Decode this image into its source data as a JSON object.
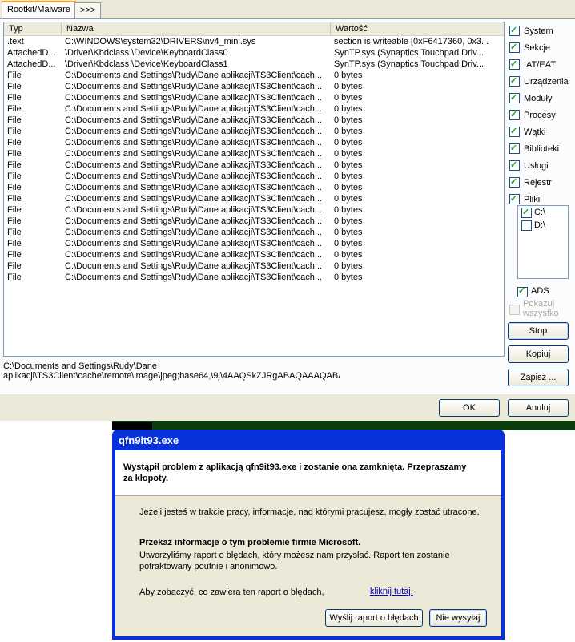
{
  "tabs": [
    {
      "label": "Rootkit/Malware"
    },
    {
      "label": ">>>"
    }
  ],
  "list": {
    "columns": [
      "Typ",
      "Nazwa",
      "Wartość"
    ],
    "rows": [
      [
        ".text",
        "C:\\WINDOWS\\system32\\DRIVERS\\nv4_mini.sys",
        "section is writeable [0xF6417360, 0x3..."
      ],
      [
        "AttachedD...",
        "\\Driver\\Kbdclass \\Device\\KeyboardClass0",
        "SynTP.sys (Synaptics Touchpad Driv..."
      ],
      [
        "AttachedD...",
        "\\Driver\\Kbdclass \\Device\\KeyboardClass1",
        "SynTP.sys (Synaptics Touchpad Driv..."
      ],
      [
        "File",
        "C:\\Documents and Settings\\Rudy\\Dane aplikacji\\TS3Client\\cach...",
        "0 bytes"
      ],
      [
        "File",
        "C:\\Documents and Settings\\Rudy\\Dane aplikacji\\TS3Client\\cach...",
        "0 bytes"
      ],
      [
        "File",
        "C:\\Documents and Settings\\Rudy\\Dane aplikacji\\TS3Client\\cach...",
        "0 bytes"
      ],
      [
        "File",
        "C:\\Documents and Settings\\Rudy\\Dane aplikacji\\TS3Client\\cach...",
        "0 bytes"
      ],
      [
        "File",
        "C:\\Documents and Settings\\Rudy\\Dane aplikacji\\TS3Client\\cach...",
        "0 bytes"
      ],
      [
        "File",
        "C:\\Documents and Settings\\Rudy\\Dane aplikacji\\TS3Client\\cach...",
        "0 bytes"
      ],
      [
        "File",
        "C:\\Documents and Settings\\Rudy\\Dane aplikacji\\TS3Client\\cach...",
        "0 bytes"
      ],
      [
        "File",
        "C:\\Documents and Settings\\Rudy\\Dane aplikacji\\TS3Client\\cach...",
        "0 bytes"
      ],
      [
        "File",
        "C:\\Documents and Settings\\Rudy\\Dane aplikacji\\TS3Client\\cach...",
        "0 bytes"
      ],
      [
        "File",
        "C:\\Documents and Settings\\Rudy\\Dane aplikacji\\TS3Client\\cach...",
        "0 bytes"
      ],
      [
        "File",
        "C:\\Documents and Settings\\Rudy\\Dane aplikacji\\TS3Client\\cach...",
        "0 bytes"
      ],
      [
        "File",
        "C:\\Documents and Settings\\Rudy\\Dane aplikacji\\TS3Client\\cach...",
        "0 bytes"
      ],
      [
        "File",
        "C:\\Documents and Settings\\Rudy\\Dane aplikacji\\TS3Client\\cach...",
        "0 bytes"
      ],
      [
        "File",
        "C:\\Documents and Settings\\Rudy\\Dane aplikacji\\TS3Client\\cach...",
        "0 bytes"
      ],
      [
        "File",
        "C:\\Documents and Settings\\Rudy\\Dane aplikacji\\TS3Client\\cach...",
        "0 bytes"
      ],
      [
        "File",
        "C:\\Documents and Settings\\Rudy\\Dane aplikacji\\TS3Client\\cach...",
        "0 bytes"
      ],
      [
        "File",
        "C:\\Documents and Settings\\Rudy\\Dane aplikacji\\TS3Client\\cach...",
        "0 bytes"
      ],
      [
        "File",
        "C:\\Documents and Settings\\Rudy\\Dane aplikacji\\TS3Client\\cach...",
        "0 bytes"
      ],
      [
        "File",
        "C:\\Documents and Settings\\Rudy\\Dane aplikacji\\TS3Client\\cach...",
        "0 bytes"
      ]
    ]
  },
  "path_text": {
    "line1": "C:\\Documents and Settings\\Rudy\\Dane",
    "line2": "aplikacji\\TS3Client\\cache\\remote\\image\\jpeg;base64,\\9j\\4AAQSkZJRgABAQAAAQABA"
  },
  "options": [
    {
      "label": "System",
      "checked": true
    },
    {
      "label": "Sekcje",
      "checked": true
    },
    {
      "label": "IAT/EAT",
      "checked": true
    },
    {
      "label": "Urządzenia",
      "checked": true
    },
    {
      "label": "Moduły",
      "checked": true
    },
    {
      "label": "Procesy",
      "checked": true
    },
    {
      "label": "Wątki",
      "checked": true
    },
    {
      "label": "Biblioteki",
      "checked": true
    },
    {
      "label": "Usługi",
      "checked": true
    },
    {
      "label": "Rejestr",
      "checked": true
    },
    {
      "label": "Pliki",
      "checked": true
    }
  ],
  "drives": [
    {
      "label": "C:\\",
      "checked": true
    },
    {
      "label": "D:\\",
      "checked": false
    }
  ],
  "ads": {
    "label": "ADS",
    "checked": true
  },
  "pokazuj": {
    "label": "Pokazuj wszystko",
    "checked": false,
    "disabled": true
  },
  "buttons": {
    "stop": "Stop",
    "kopiuj": "Kopiuj",
    "zapisz": "Zapisz ...",
    "ok": "OK",
    "anuluj": "Anuluj"
  },
  "error_dialog": {
    "title": "qfn9it93.exe",
    "headline": "Wystąpił problem z aplikacją qfn9it93.exe i zostanie ona zamknięta. Przepraszamy za kłopoty.",
    "info": "Jeżeli jesteś w trakcie pracy, informacje, nad którymi pracujesz, mogły zostać utracone.",
    "report_heading": "Przekaż informacje o tym problemie firmie Microsoft.",
    "report_text": "Utworzyliśmy raport o błędach, który możesz nam przysłać. Raport ten zostanie potraktowany poufnie i anonimowo.",
    "see_text": "Aby zobaczyć, co zawiera ten raport o błędach,",
    "link": "kliknij tutaj.",
    "send_button": "Wyślij raport o błędach",
    "dont_send_button": "Nie wysyłaj"
  },
  "colors": {
    "title_bar": "#0831d9",
    "dialog_bg": "#ece9d8",
    "check_mark": "#21a121"
  }
}
